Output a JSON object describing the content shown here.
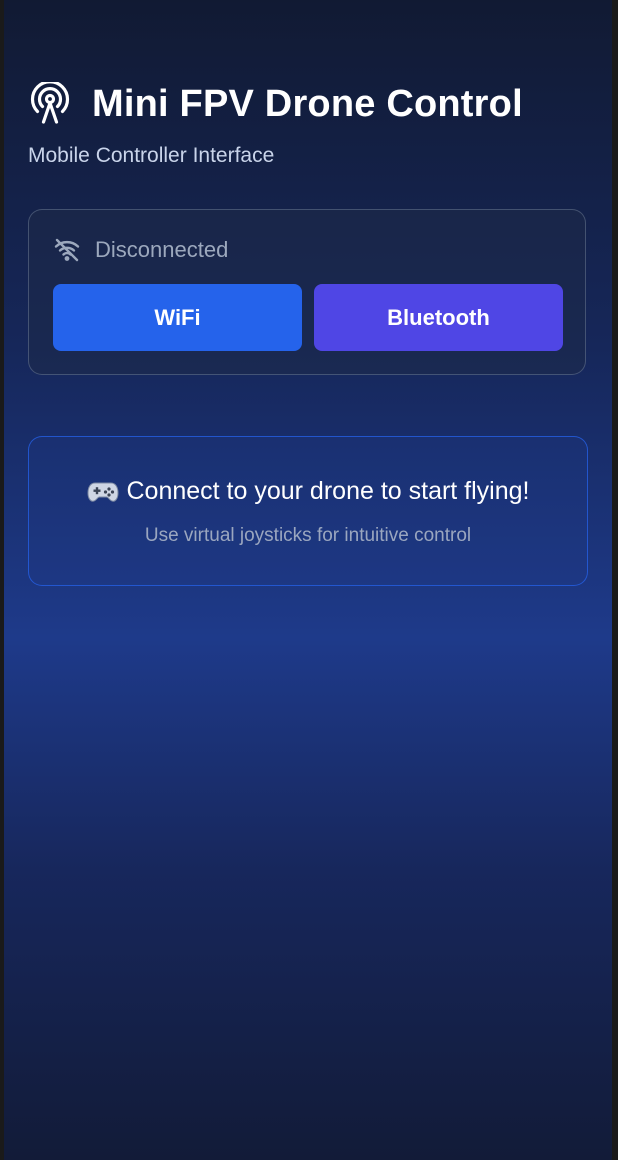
{
  "app": {
    "title": "Mini FPV Drone Control",
    "subtitle": "Mobile Controller Interface",
    "icon": "broadcast-antenna-icon"
  },
  "connection": {
    "status": "Disconnected",
    "status_icon": "wifi-off-icon",
    "buttons": {
      "wifi_label": "WiFi",
      "bluetooth_label": "Bluetooth"
    }
  },
  "info": {
    "icon": "gamepad-icon",
    "title": "Connect to your drone to start flying!",
    "subtitle": "Use virtual joysticks for intuitive control"
  },
  "colors": {
    "wifi_button": "#2563eb",
    "bluetooth_button": "#4f46e5",
    "info_border": "#2563eb",
    "status_text": "#9ca8bd"
  }
}
